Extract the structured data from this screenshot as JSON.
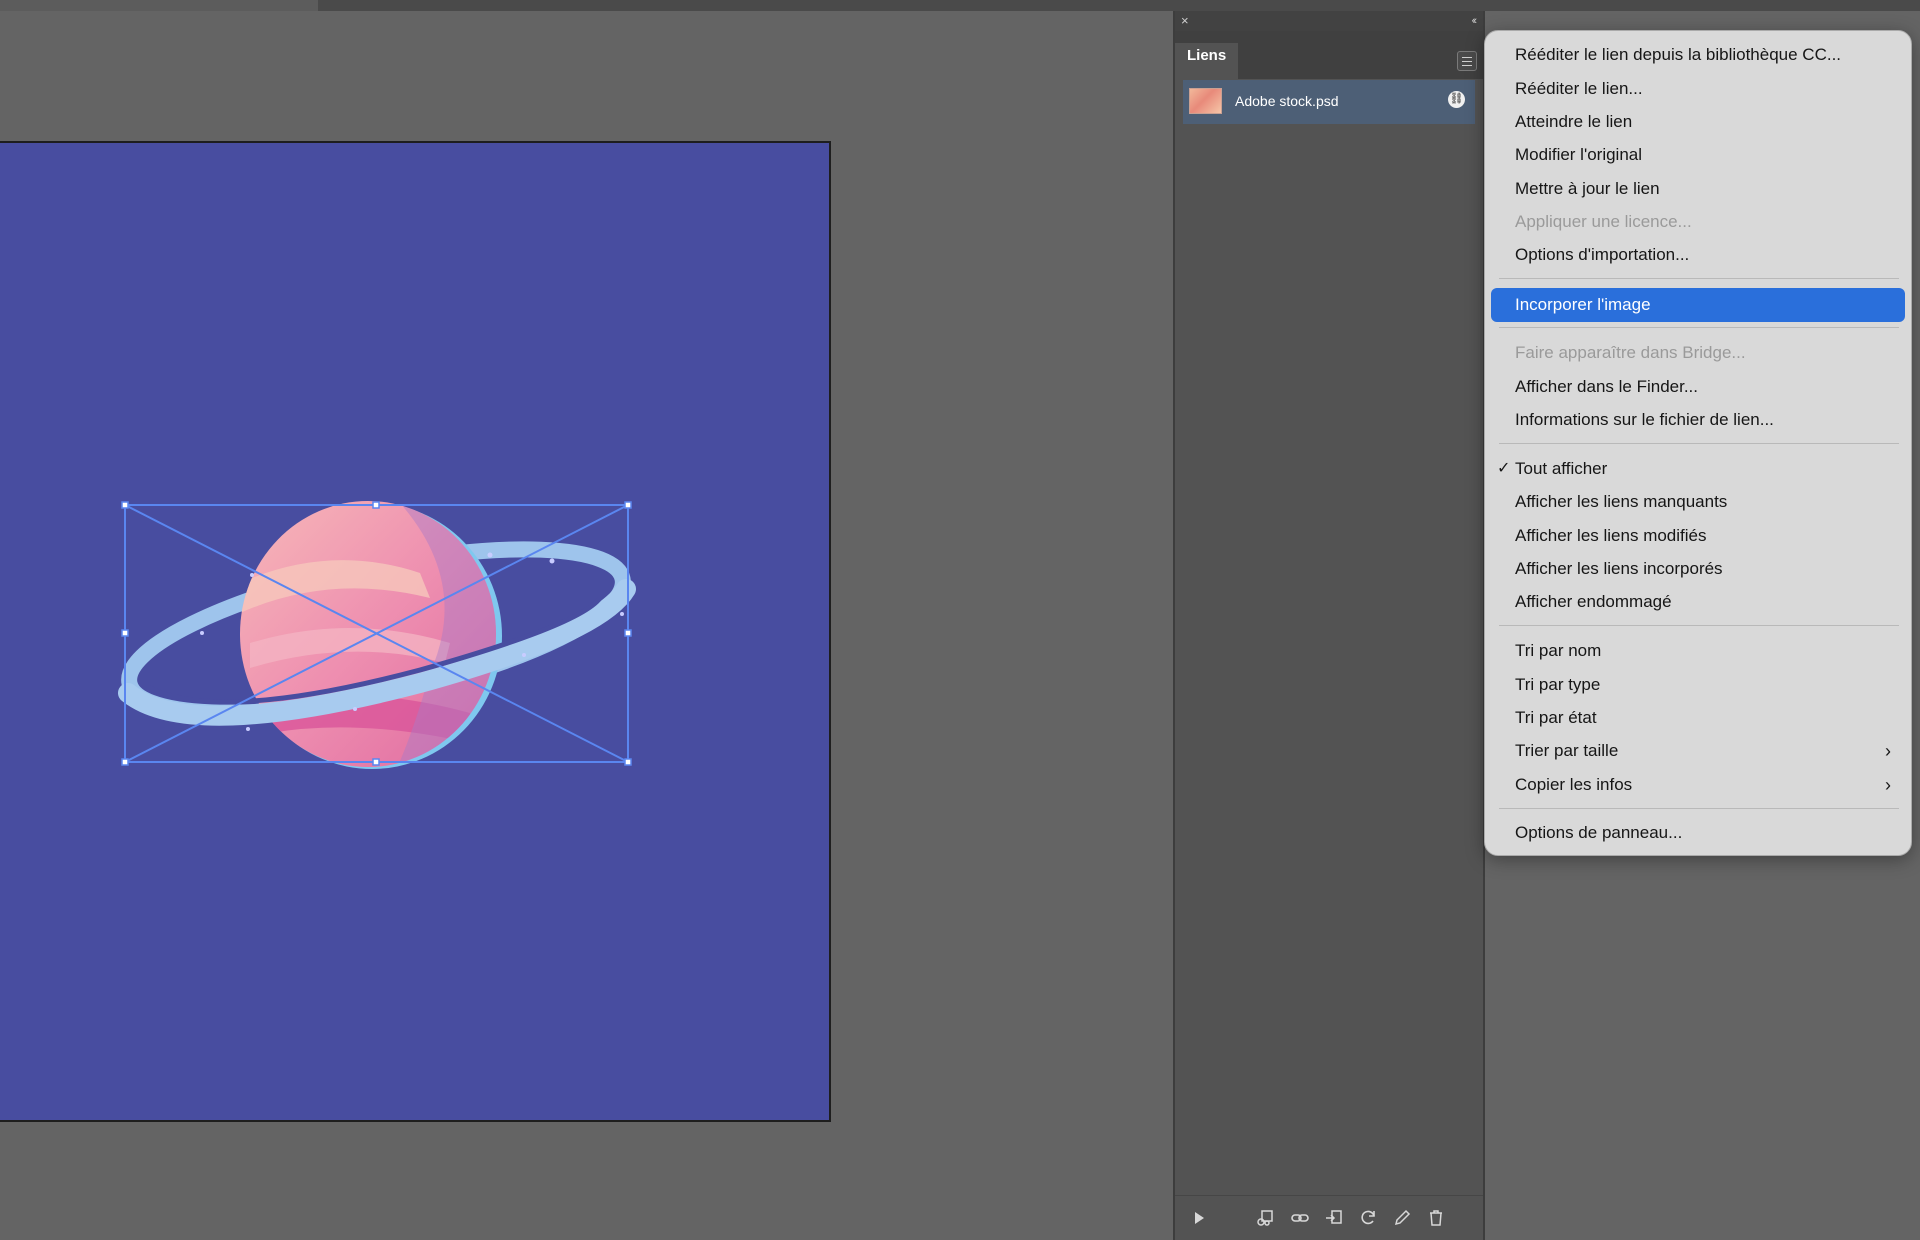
{
  "panel": {
    "tab_label": "Liens",
    "close_glyph": "×",
    "collapse_glyph": "‹‹",
    "link": {
      "name": "Adobe stock.psd",
      "status_icon": "linked-icon"
    }
  },
  "menu": {
    "items": [
      {
        "label": "Rééditer le lien depuis la bibliothèque CC...",
        "disabled": false
      },
      {
        "label": "Rééditer le lien...",
        "disabled": false
      },
      {
        "label": "Atteindre le lien",
        "disabled": false
      },
      {
        "label": "Modifier l'original",
        "disabled": false
      },
      {
        "label": "Mettre à jour le lien",
        "disabled": false
      },
      {
        "label": "Appliquer une licence...",
        "disabled": true
      },
      {
        "label": "Options d'importation...",
        "disabled": false
      },
      {
        "label": "Incorporer l'image",
        "selected": true
      },
      {
        "label": "Faire apparaître dans Bridge...",
        "disabled": true
      },
      {
        "label": "Afficher dans le Finder...",
        "disabled": false
      },
      {
        "label": "Informations sur le fichier de lien...",
        "disabled": false
      },
      {
        "label": "Tout afficher",
        "checked": true
      },
      {
        "label": "Afficher les liens manquants"
      },
      {
        "label": "Afficher les liens modifiés"
      },
      {
        "label": "Afficher les liens incorporés"
      },
      {
        "label": "Afficher endommagé"
      },
      {
        "label": "Tri par nom"
      },
      {
        "label": "Tri par type"
      },
      {
        "label": "Tri par état"
      },
      {
        "label": "Trier par taille",
        "submenu": true
      },
      {
        "label": "Copier les infos",
        "submenu": true
      },
      {
        "label": "Options de panneau..."
      }
    ],
    "check_glyph": "✓",
    "submenu_glyph": "›"
  },
  "colors": {
    "artboard": "#484da0",
    "selection": "#2a6fdb",
    "canvas": "#646464"
  }
}
